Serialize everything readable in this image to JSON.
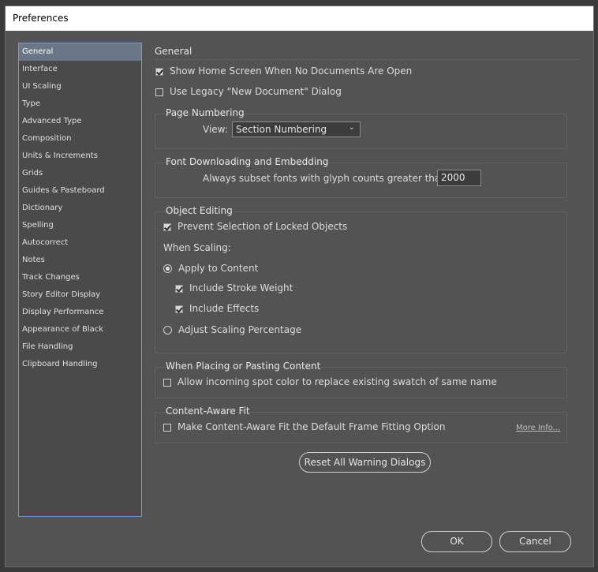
{
  "window": {
    "title": "Preferences"
  },
  "sidebar": {
    "items": [
      {
        "label": "General",
        "selected": true
      },
      {
        "label": "Interface"
      },
      {
        "label": "UI Scaling"
      },
      {
        "label": "Type"
      },
      {
        "label": "Advanced Type"
      },
      {
        "label": "Composition"
      },
      {
        "label": "Units & Increments"
      },
      {
        "label": "Grids"
      },
      {
        "label": "Guides & Pasteboard"
      },
      {
        "label": "Dictionary"
      },
      {
        "label": "Spelling"
      },
      {
        "label": "Autocorrect"
      },
      {
        "label": "Notes"
      },
      {
        "label": "Track Changes"
      },
      {
        "label": "Story Editor Display"
      },
      {
        "label": "Display Performance"
      },
      {
        "label": "Appearance of Black"
      },
      {
        "label": "File Handling"
      },
      {
        "label": "Clipboard Handling"
      }
    ]
  },
  "general": {
    "heading": "General",
    "show_home_screen": {
      "label": "Show Home Screen When No Documents Are Open",
      "checked": true
    },
    "legacy_dialog": {
      "label": "Use Legacy \"New Document\" Dialog",
      "checked": false
    }
  },
  "page_numbering": {
    "title": "Page Numbering",
    "view_label": "View:",
    "view_value": "Section Numbering"
  },
  "font_downloading": {
    "title": "Font Downloading and Embedding",
    "subset_label": "Always subset fonts with glyph counts greater than:",
    "subset_value": "2000"
  },
  "object_editing": {
    "title": "Object Editing",
    "prevent_locked": {
      "label": "Prevent Selection of Locked Objects",
      "checked": true
    },
    "when_scaling": "When Scaling:",
    "apply_to_content": {
      "label": "Apply to Content",
      "selected": true
    },
    "include_stroke": {
      "label": "Include Stroke Weight",
      "checked": true
    },
    "include_effects": {
      "label": "Include Effects",
      "checked": true
    },
    "adjust_scaling": {
      "label": "Adjust Scaling Percentage",
      "selected": false
    }
  },
  "placing": {
    "title": "When Placing or Pasting Content",
    "spot_color": {
      "label": "Allow incoming spot color to replace existing swatch of same name",
      "checked": false
    }
  },
  "content_aware": {
    "title": "Content-Aware Fit",
    "default_fit": {
      "label": "Make Content-Aware Fit the Default Frame Fitting Option",
      "checked": false
    },
    "more_info": "More Info..."
  },
  "buttons": {
    "reset_warnings": "Reset All Warning Dialogs",
    "ok": "OK",
    "cancel": "Cancel"
  },
  "colors": {
    "panel_bg": "#535353",
    "selection": "#6b7787",
    "sidebar_border": "#6ea0d8"
  }
}
